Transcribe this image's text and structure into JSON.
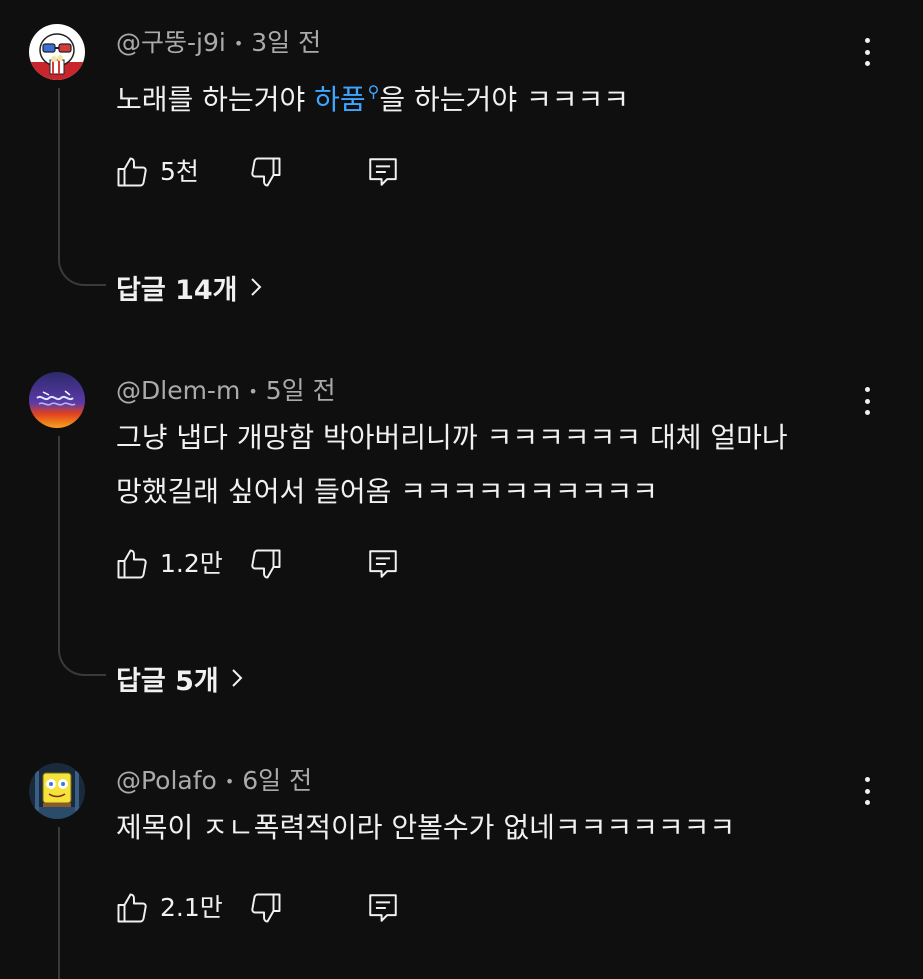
{
  "comments": [
    {
      "author": "@구뚱-j9i",
      "time": "3일 전",
      "text_before": "노래를 하는거야 ",
      "hashtag": "하품",
      "text_after": "을 하는거야 ㅋㅋㅋㅋ",
      "like_count": "5천",
      "replies_label": "답글 14개",
      "avatar_icon": "cartoon-character-avatar-icon"
    },
    {
      "author": "@Dlem-m",
      "time": "5일 전",
      "line1": "그냥 냅다 개망함 박아버리니까 ㅋㅋㅋㅋㅋㅋ 대체 얼마나",
      "line2": "망했길래 싶어서 들어옴 ㅋㅋㅋㅋㅋㅋㅋㅋㅋㅋ",
      "like_count": "1.2만",
      "replies_label": "답글 5개",
      "avatar_icon": "abstract-wave-avatar-icon"
    },
    {
      "author": "@Polafo",
      "time": "6일 전",
      "text": "제목이 ㅈㄴ폭력적이라 안볼수가 없네ㅋㅋㅋㅋㅋㅋㅋ",
      "like_count": "2.1만",
      "avatar_icon": "spongebob-avatar-icon"
    }
  ],
  "colors": {
    "background": "#0f0f0f",
    "text": "#f1f1f1",
    "meta": "#aaaaaa",
    "hashtag": "#3ea6ff",
    "thread_line": "#3a3a3a"
  },
  "icons": {
    "like": "thumbs-up-icon",
    "dislike": "thumbs-down-icon",
    "reply": "reply-comment-icon",
    "menu": "more-vert-icon",
    "chevron": "chevron-right-icon"
  }
}
